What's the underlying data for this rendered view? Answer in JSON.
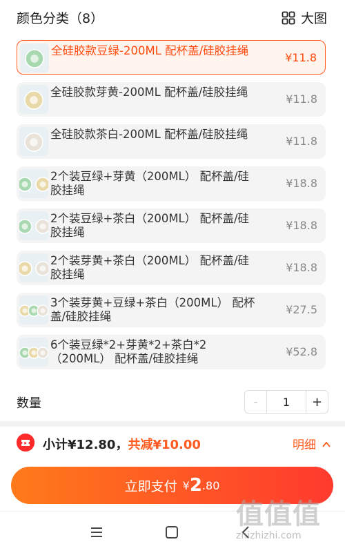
{
  "header": {
    "title": "颜色分类（8）",
    "big_view_label": "大图"
  },
  "options": [
    {
      "name": "全硅胶款豆绿-200ML 配杯盖/硅胶挂绳",
      "price": "¥11.8",
      "selected": true,
      "thumb_colors": [
        "#a8d8b0"
      ]
    },
    {
      "name": "全硅胶款芽黄-200ML 配杯盖/硅胶挂绳",
      "price": "¥11.8",
      "selected": false,
      "thumb_colors": [
        "#e9d9a8"
      ]
    },
    {
      "name": "全硅胶款茶白-200ML 配杯盖/硅胶挂绳",
      "price": "¥11.8",
      "selected": false,
      "thumb_colors": [
        "#e8e2d8"
      ]
    },
    {
      "name": "2个装豆绿+芽黄（200ML） 配杯盖/硅胶挂绳",
      "price": "¥18.8",
      "selected": false,
      "thumb_colors": [
        "#a8d8b0",
        "#e9d9a8"
      ]
    },
    {
      "name": "2个装豆绿+茶白（200ML） 配杯盖/硅胶挂绳",
      "price": "¥18.8",
      "selected": false,
      "thumb_colors": [
        "#a8d8b0",
        "#e8e2d8"
      ]
    },
    {
      "name": "2个装芽黄+茶白（200ML） 配杯盖/硅胶挂绳",
      "price": "¥18.8",
      "selected": false,
      "thumb_colors": [
        "#e9d9a8",
        "#e8e2d8"
      ]
    },
    {
      "name": "3个装芽黄+豆绿+茶白（200ML） 配杯盖/硅胶挂绳",
      "price": "¥27.5",
      "selected": false,
      "thumb_colors": [
        "#e9d9a8",
        "#a8d8b0",
        "#e8e2d8"
      ]
    },
    {
      "name": "6个装豆绿*2+芽黄*2+茶白*2（200ML） 配杯盖/硅胶挂绳",
      "price": "¥52.8",
      "selected": false,
      "thumb_colors": [
        "#a8d8b0",
        "#e9d9a8",
        "#e8e2d8"
      ]
    }
  ],
  "quantity": {
    "label": "数量",
    "minus": "-",
    "value": "1",
    "plus": "+"
  },
  "subtotal": {
    "text_prefix": "小计¥12.80，",
    "discount_text": "共减¥10.00",
    "detail_label": "明细"
  },
  "pay": {
    "label": "立即支付",
    "currency": "¥",
    "amount_int": "2",
    "amount_dec": ".80"
  },
  "watermark": {
    "logo_text": "值值值",
    "url": "zhizhizhi.com"
  },
  "colors": {
    "accent": "#ff5a1f",
    "pay_gradient_start": "#ff7a1a",
    "pay_gradient_end": "#ff3a2e"
  }
}
